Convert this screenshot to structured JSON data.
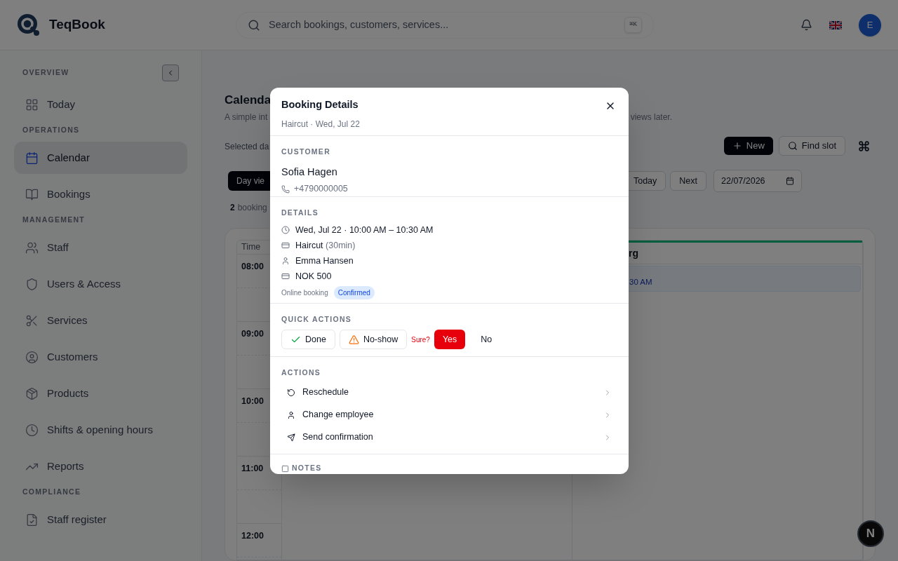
{
  "app": {
    "name": "TeqBook"
  },
  "search": {
    "placeholder": "Search bookings, customers, services...",
    "shortcut": "⌘K"
  },
  "header": {
    "avatar": "E"
  },
  "sidebar": {
    "sections": [
      {
        "title": "OVERVIEW",
        "items": [
          {
            "label": "Today",
            "selected": false
          }
        ]
      },
      {
        "title": "OPERATIONS",
        "items": [
          {
            "label": "Calendar",
            "selected": true
          },
          {
            "label": "Bookings",
            "selected": false
          }
        ]
      },
      {
        "title": "MANAGEMENT",
        "items": [
          {
            "label": "Staff",
            "selected": false
          },
          {
            "label": "Users & Access",
            "selected": false
          },
          {
            "label": "Services",
            "selected": false
          },
          {
            "label": "Customers",
            "selected": false
          },
          {
            "label": "Products",
            "selected": false
          },
          {
            "label": "Shifts & opening hours",
            "selected": false
          },
          {
            "label": "Reports",
            "selected": false
          }
        ]
      },
      {
        "title": "COMPLIANCE",
        "items": [
          {
            "label": "Staff register",
            "selected": false
          }
        ]
      }
    ]
  },
  "main": {
    "title": "Calenda",
    "subtitle_start": "A simple int",
    "subtitle_end": "views later.",
    "selected_date": "Selected da",
    "new_button": "New",
    "find_slot_button": "Find slot",
    "view_button": "Day vie",
    "today_button": "Today",
    "next_button": "Next",
    "date": "22/07/2026",
    "count": "2",
    "count_label": "booking"
  },
  "calendar": {
    "time_header": "Time",
    "hours": [
      "08:00",
      "09:00",
      "10:00",
      "11:00",
      "12:00"
    ],
    "columns": [
      {},
      {
        "header": "rg",
        "events": [
          {
            "time": "30 AM"
          }
        ]
      }
    ]
  },
  "dev_badge": "N",
  "modal": {
    "title": "Booking Details",
    "subtitle": "Haircut · Wed, Jul 22",
    "customer": {
      "label": "CUSTOMER",
      "name": "Sofia Hagen",
      "phone": "+4790000005"
    },
    "details": {
      "label": "DETAILS",
      "rows": [
        {
          "text": "Wed, Jul 22 · 10:00 AM – 10:30 AM"
        },
        {
          "text": "Haircut",
          "note": "(30min)"
        },
        {
          "text": "Emma Hansen"
        },
        {
          "text": "NOK 500"
        }
      ],
      "source": "Online booking",
      "status": "Confirmed"
    },
    "quick_actions": {
      "label": "QUICK ACTIONS",
      "buttons": [
        {
          "label": "Done",
          "kind": "done"
        },
        {
          "label": "No-show",
          "kind": "noshow"
        }
      ],
      "confirm": {
        "prompt": "Sure?",
        "yes": "Yes",
        "no": "No"
      }
    },
    "actions": {
      "label": "ACTIONS",
      "items": [
        "Reschedule",
        "Change employee",
        "Send confirmation"
      ]
    },
    "notes": {
      "label": "NOTES"
    }
  }
}
